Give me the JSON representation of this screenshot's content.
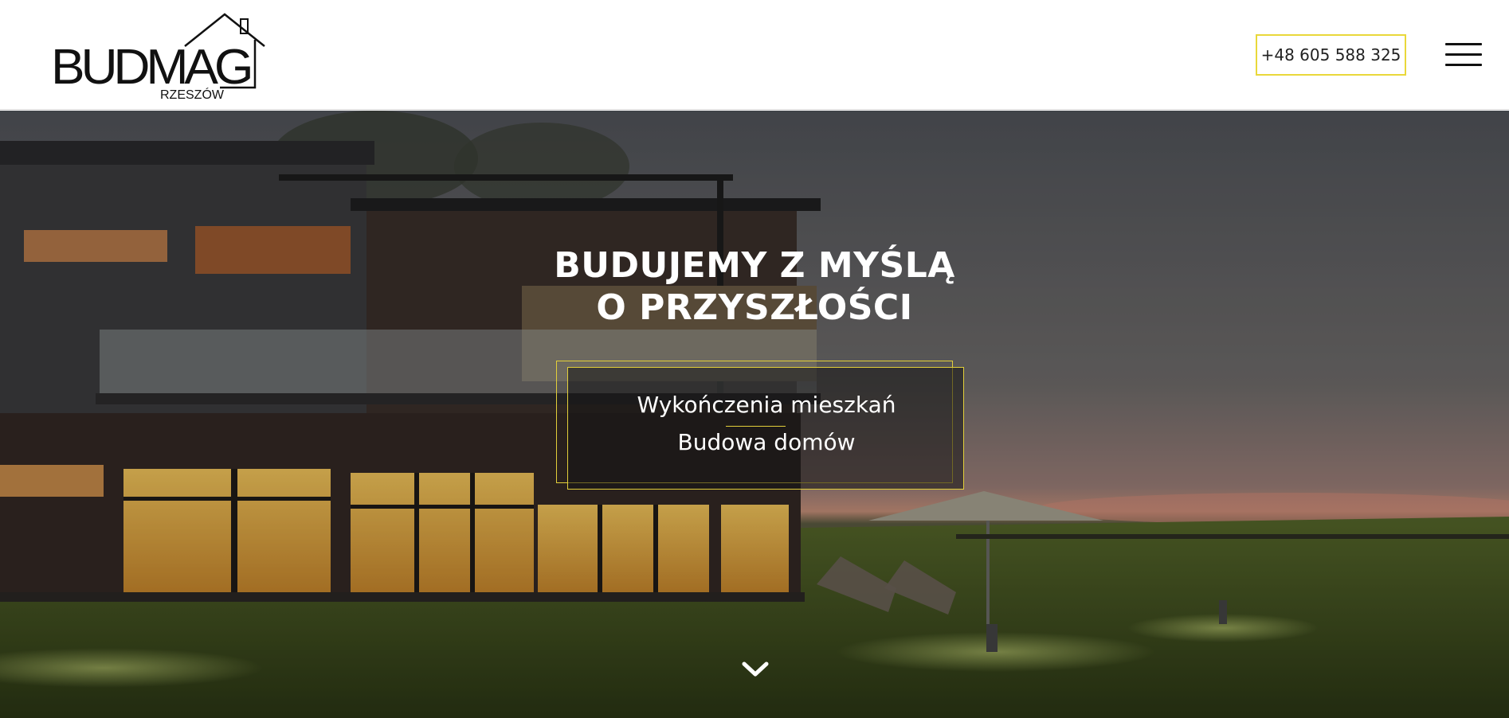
{
  "header": {
    "logo_text": "BUDMAG",
    "logo_subtext": "RZESZÓW",
    "phone": "+48 605 588 325"
  },
  "hero": {
    "title_line1": "BUDUJEMY Z MYŚLĄ",
    "title_line2": "O PRZYSZŁOŚCI",
    "services": [
      "Wykończenia mieszkań",
      "Budowa domów"
    ],
    "scroll_icon": "chevron-down-icon"
  },
  "colors": {
    "accent": "#e2cf3a",
    "header_bg": "#ffffff",
    "text_dark": "#111111"
  }
}
